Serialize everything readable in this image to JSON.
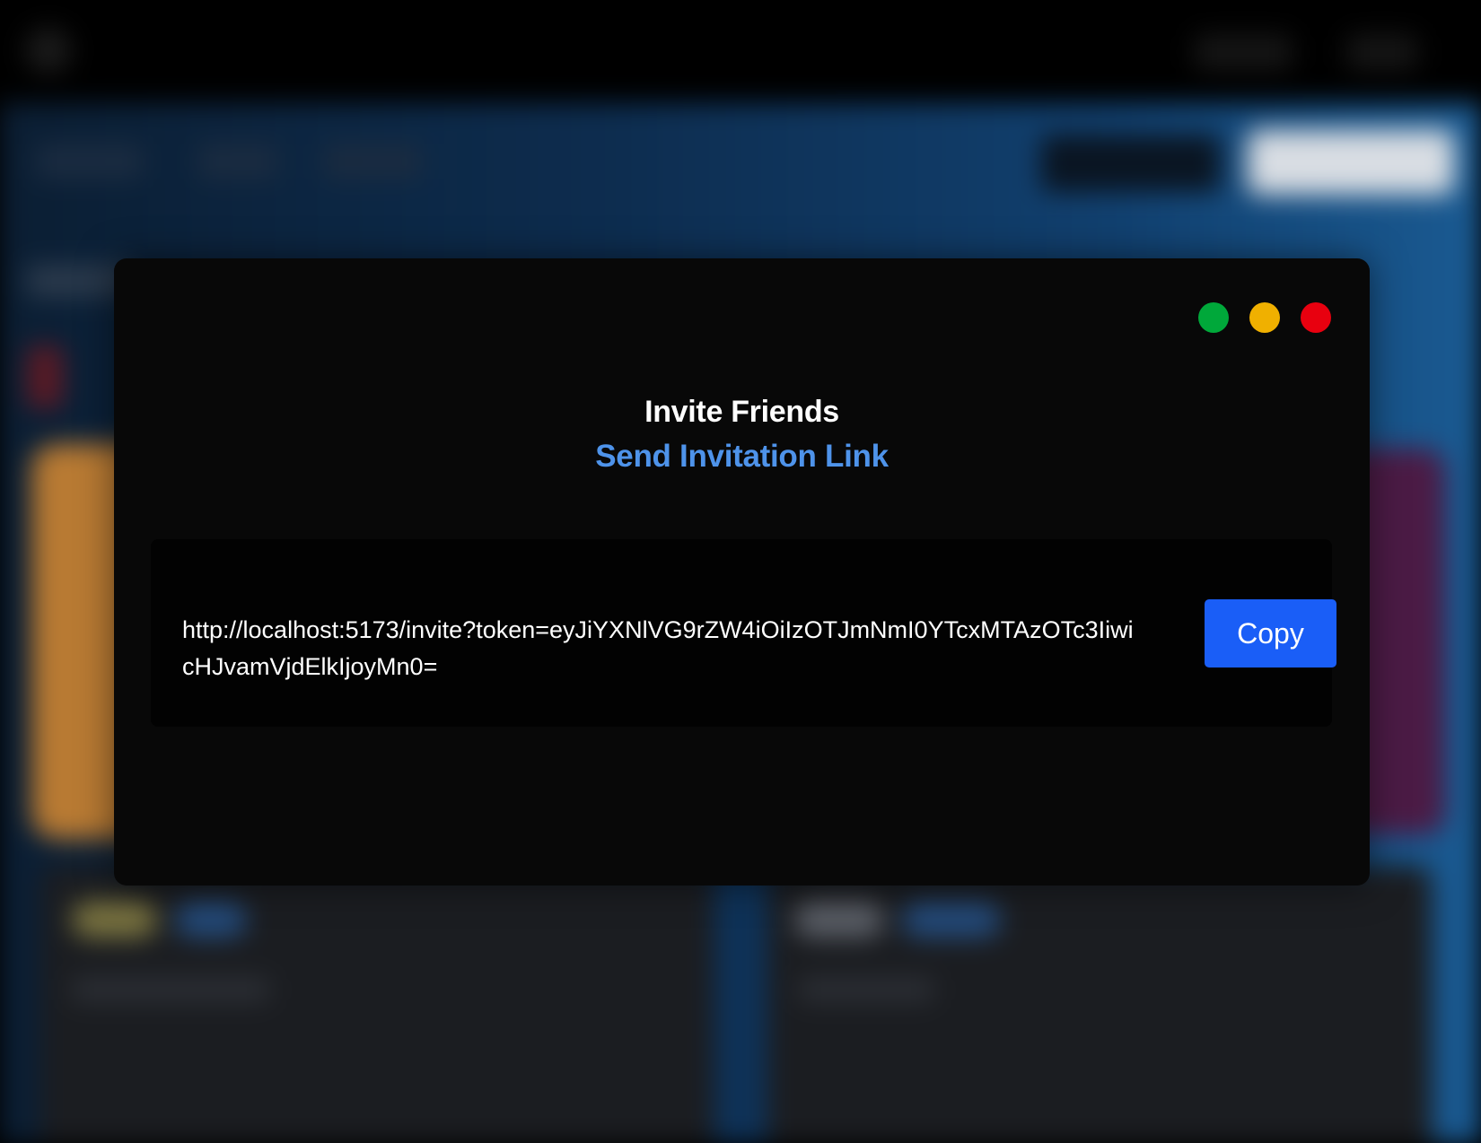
{
  "modal": {
    "title": "Invite Friends",
    "subtitle": "Send Invitation Link",
    "invite_link": "http://localhost:5173/invite?token=eyJiYXNlVG9rZW4iOiIzOTJmNmI0YTcxMTAzOTc3IiwicHJvamVjdElkIjoyMn0=",
    "copy_label": "Copy",
    "window_controls": [
      {
        "name": "maximize",
        "color": "#00a83a"
      },
      {
        "name": "minimize",
        "color": "#f0b000"
      },
      {
        "name": "close",
        "color": "#e8000f"
      }
    ]
  },
  "colors": {
    "accent": "#1a5ef7",
    "subtitle": "#4e93ea",
    "modal_bg": "#080808",
    "link_box_bg": "#020202"
  }
}
